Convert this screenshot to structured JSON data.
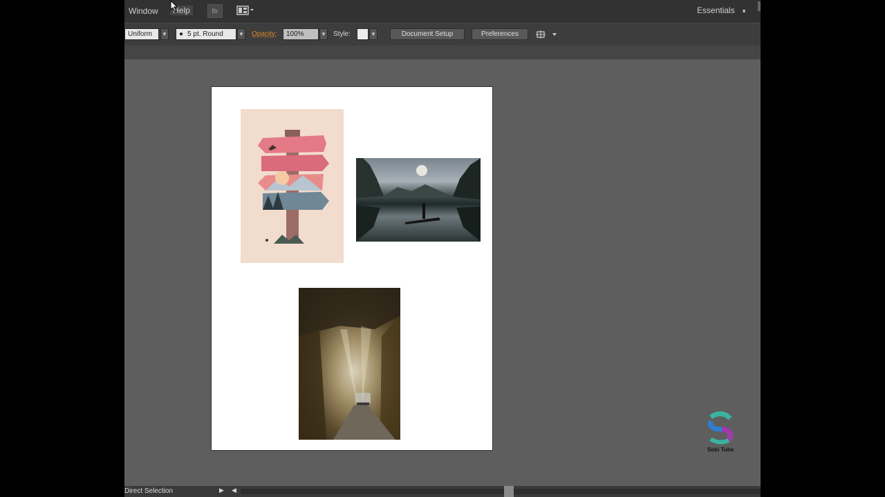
{
  "menu": {
    "window": "Window",
    "help": "Help"
  },
  "workspace": {
    "label": "Essentials"
  },
  "control": {
    "stroke_profile": "Uniform",
    "brush": "5 pt. Round",
    "opacity_label": "Opacity:",
    "opacity_value": "100%",
    "style_label": "Style:",
    "document_setup": "Document Setup",
    "preferences": "Preferences"
  },
  "status": {
    "tool": "Direct Selection"
  },
  "watermark": {
    "text": "Sobi Tube"
  },
  "colors": {
    "accent_opacity": "#e08a2a",
    "canvas": "#5e5e5e",
    "panel": "#323232"
  },
  "icons": [
    "bridge-icon",
    "arrange-documents-icon",
    "cursor-icon",
    "chevron-down-icon"
  ]
}
